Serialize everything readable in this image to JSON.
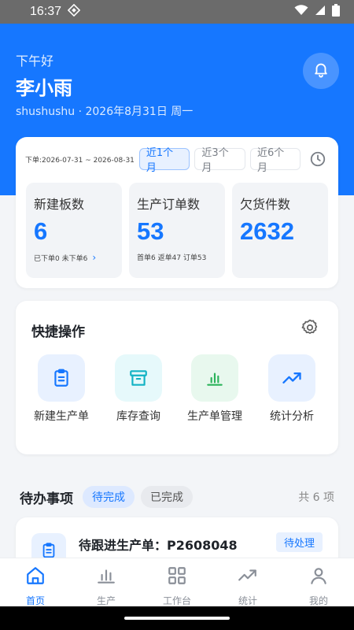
{
  "status_bar": {
    "time": "16:37"
  },
  "header": {
    "greeting": "下午好",
    "user_name": "李小雨",
    "subline": "shushushu · 2026年8月31日 周一"
  },
  "stats": {
    "date_range": "下单:2026-07-31 ~ 2026-08-31",
    "ranges": [
      "近1个月",
      "近3个月",
      "近6个月"
    ],
    "selected_range": "近1个月",
    "cards": [
      {
        "label": "新建板数",
        "value": "6",
        "sub": "已下单0 未下单6"
      },
      {
        "label": "生产订单数",
        "value": "53",
        "sub": "首单6 返单47 订单53"
      },
      {
        "label": "欠货件数",
        "value": "2632",
        "sub": ""
      }
    ]
  },
  "quick_actions": {
    "title": "快捷操作",
    "items": [
      {
        "label": "新建生产单",
        "icon": "clipboard-icon",
        "color": "#1677ff",
        "bg": "#e8f1ff"
      },
      {
        "label": "库存查询",
        "icon": "archive-box-icon",
        "color": "#13b3c4",
        "bg": "#e6f9fb"
      },
      {
        "label": "生产单管理",
        "icon": "bar-chart-icon",
        "color": "#2bb35a",
        "bg": "#e8f8ee"
      },
      {
        "label": "统计分析",
        "icon": "trend-up-icon",
        "color": "#1677ff",
        "bg": "#e8f1ff"
      }
    ]
  },
  "todo": {
    "title": "待办事项",
    "filters": [
      "待完成",
      "已完成"
    ],
    "selected_filter": "待完成",
    "count_text": "共 6 项",
    "items": [
      {
        "title": "待跟进生产单：P2608048",
        "badge": "待处理"
      }
    ]
  },
  "tabbar": {
    "tabs": [
      {
        "label": "首页",
        "icon": "home-icon"
      },
      {
        "label": "生产",
        "icon": "bar-chart-icon"
      },
      {
        "label": "工作台",
        "icon": "grid-icon"
      },
      {
        "label": "统计",
        "icon": "trend-up-icon"
      },
      {
        "label": "我的",
        "icon": "user-icon"
      }
    ],
    "active": "首页"
  },
  "colors": {
    "primary": "#1677ff",
    "background": "#f3f5f8"
  }
}
